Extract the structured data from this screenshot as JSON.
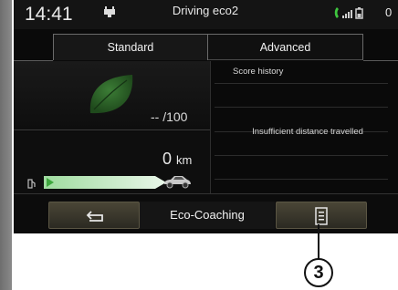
{
  "status_bar": {
    "time": "14:41",
    "title": "Driving eco2",
    "count": "0",
    "icons": [
      "charge-plug-icon",
      "phone-signal-icon"
    ]
  },
  "tabs": [
    {
      "label": "Standard",
      "active": true
    },
    {
      "label": "Advanced",
      "active": false
    }
  ],
  "score": {
    "value": "-- /100",
    "icon": "leaf-icon",
    "accent": "#2f6b2f"
  },
  "distance": {
    "value": "0",
    "unit": "km",
    "bar_color": "#6ec06e",
    "icons": [
      "fuel-pump-icon",
      "car-icon"
    ]
  },
  "history": {
    "title": "Score history",
    "message": "Insufficient distance travelled"
  },
  "bottom_bar": {
    "title": "Eco-Coaching",
    "back_icon": "back-arrow-icon",
    "menu_icon": "menu-list-icon"
  },
  "callout": {
    "label": "3"
  }
}
